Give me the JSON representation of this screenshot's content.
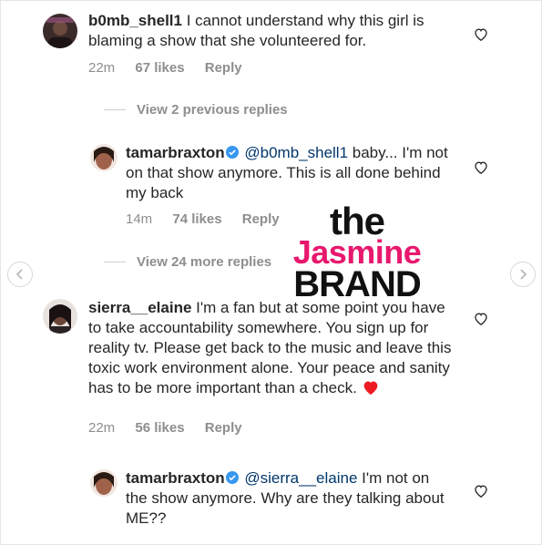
{
  "comments": [
    {
      "username": "b0mb_shell1",
      "text": " I cannot understand why this girl is blaming a show that she volunteered for.",
      "time": "22m",
      "likes": "67 likes",
      "reply": "Reply",
      "avatar_color": "#3a2a2a"
    },
    {
      "username": "tamarbraxton",
      "mention": "@b0mb_shell1",
      "text": " baby... I'm not on that show anymore. This is all done behind my back",
      "time": "14m",
      "likes": "74 likes",
      "reply": "Reply",
      "avatar_color": "#a0614a"
    },
    {
      "username": "sierra__elaine",
      "text": " I'm a fan but at some point you have to take accountability somewhere. You sign up for reality tv. Please get back to the music and leave this toxic work environment alone. Your peace and sanity has to be more important than a check. ",
      "time": "22m",
      "likes": "56 likes",
      "reply": "Reply",
      "avatar_color": "#2b2323"
    },
    {
      "username": "tamarbraxton",
      "mention": "@sierra__elaine",
      "text": " I'm not on the show anymore. Why are they talking about ME??",
      "avatar_color": "#a0614a"
    }
  ],
  "view_previous": "View 2 previous replies",
  "view_more": "View 24 more replies",
  "watermark": {
    "line1": "the",
    "line2": "Jasmine",
    "line3": "BRAND"
  },
  "icons": {
    "heart": "heart-outline-icon",
    "verified": "verified-badge-icon",
    "prev": "chevron-left-icon",
    "next": "chevron-right-icon"
  },
  "colors": {
    "mention": "#00376b",
    "verified": "#3897f0",
    "watermark_pink": "#e8186d",
    "heart_emoji": "#ed1c24"
  }
}
